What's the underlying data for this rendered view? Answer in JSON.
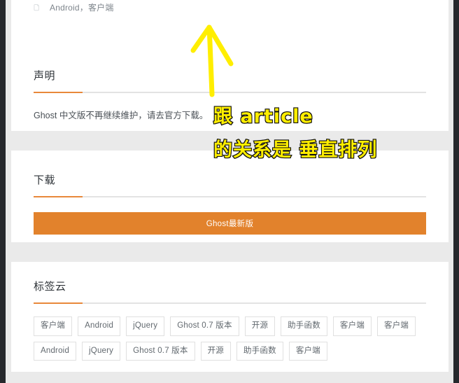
{
  "theme": {
    "accent_orange": "#e8883a",
    "button_orange": "#e2822c",
    "page_bg": "#eaeaea",
    "card_bg": "#ffffff",
    "chrome_dark": "#26282c",
    "annotation_yellow": "#ffee00",
    "text_primary": "#2e3338",
    "text_body": "#4a5056",
    "text_muted": "#7e858c"
  },
  "article_footer": {
    "icon": "tag-icon",
    "tags_text": "Android，客户端"
  },
  "statement_section": {
    "heading": "声明",
    "body": "Ghost 中文版不再继续维护，请去官方下载。"
  },
  "download_section": {
    "heading": "下载",
    "button_label": "Ghost最新版"
  },
  "tagcloud_section": {
    "heading": "标签云",
    "tags": [
      "客户端",
      "Android",
      "jQuery",
      "Ghost 0.7 版本",
      "开源",
      "助手函数",
      "客户端",
      "客户端",
      "Android",
      "jQuery",
      "Ghost 0.7 版本",
      "开源",
      "助手函数",
      "客户端"
    ]
  },
  "annotation": {
    "line1": "跟 article",
    "line2": "的关系是 垂直排列",
    "arrow": "up-arrow-annotation"
  }
}
